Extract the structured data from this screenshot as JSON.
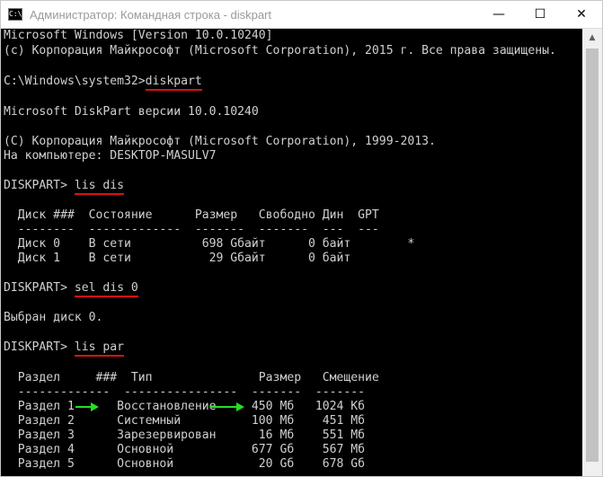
{
  "window": {
    "title": "Администратор: Командная строка - diskpart",
    "icon_text": "C:\\",
    "minimize_symbol": "—",
    "maximize_symbol": "☐",
    "close_symbol": "✕"
  },
  "console": {
    "header1": "Microsoft Windows [Version 10.0.10240]",
    "header2": "(c) Корпорация Майкрософт (Microsoft Corporation), 2015 г. Все права защищены.",
    "prompt1": "C:\\Windows\\system32>",
    "cmd1": "diskpart",
    "diskpart_version": "Microsoft DiskPart версии 10.0.10240",
    "copyright": "(C) Корпорация Майкрософт (Microsoft Corporation), 1999-2013.",
    "computer": "На компьютере: DESKTOP-MASULV7",
    "prompt2": "DISKPART> ",
    "cmd2": "lis dis",
    "disk_header": "  Диск ###  Состояние      Размер   Свободно Дин  GPT",
    "disk_sep": "  --------  -------------  -------  -------  ---  ---",
    "disk_rows": [
      "  Диск 0    В сети          698 Gбайт      0 байт        *",
      "  Диск 1    В сети           29 Gбайт      0 байт"
    ],
    "prompt3": "DISKPART> ",
    "cmd3": "sel dis 0",
    "selected": "Выбран диск 0.",
    "prompt4": "DISKPART> ",
    "cmd4": "lis par",
    "part_header": "  Раздел     ###  Тип               Размер   Смещение",
    "part_sep": "  -------------  ----------------  -------  -------",
    "part_rows": [
      "  Раздел 1      Восстановление     450 Мб   1024 Кб",
      "  Раздел 2      Системный          100 Мб    451 Мб",
      "  Раздел 3      Зарезервирован      16 Мб    551 Мб",
      "  Раздел 4      Основной           677 Gб    567 Мб",
      "  Раздел 5      Основной            20 Gб    678 Gб"
    ]
  },
  "colors": {
    "console_bg": "#000000",
    "console_text": "#d0d0d0",
    "underline": "#e01010",
    "arrow": "#22e022"
  },
  "icons": {
    "app": "cmd-icon",
    "scroll_up": "scroll-up-arrow-icon"
  }
}
